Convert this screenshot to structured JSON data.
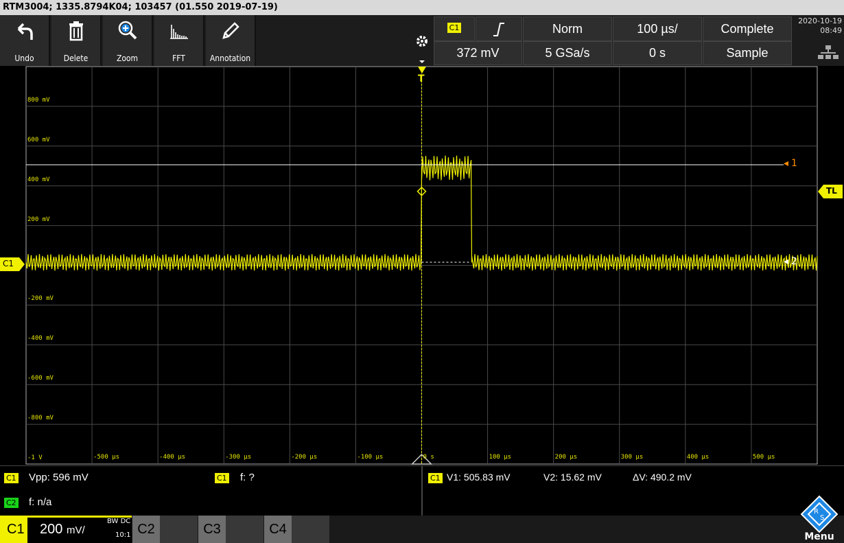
{
  "title_bar": "RTM3004; 1335.8794K04; 103457 (01.550 2019-07-19)",
  "toolbar": {
    "undo": "Undo",
    "delete": "Delete",
    "zoom": "Zoom",
    "fft": "FFT",
    "annotation": "Annotation"
  },
  "trigger": {
    "source": "C1",
    "mode": "Norm",
    "timebase": "100 µs/",
    "acq_state": "Complete",
    "level": "372 mV",
    "sample_rate": "5 GSa/s",
    "position": "0 s",
    "acq_mode": "Sample"
  },
  "datetime": {
    "date": "2020-10-19",
    "time": "08:49"
  },
  "colors": {
    "ch1": "#f0f000",
    "ch2": "#19d319",
    "marker": "#ff8c00"
  },
  "icons": [
    "undo-icon",
    "trash-icon",
    "zoom-icon",
    "fft-icon",
    "pen-icon",
    "gear-icon",
    "rising-edge-icon",
    "network-icon",
    "rs-logo-icon"
  ],
  "markers": {
    "ch1": "C1",
    "trigger": "T",
    "trigger_level": "TL",
    "cursor1": "1",
    "cursor2": "2"
  },
  "chart_data": {
    "type": "line",
    "title": "",
    "xlabel": "",
    "ylabel": "",
    "xlim": [
      -600,
      600
    ],
    "ylim": [
      -1000,
      1000
    ],
    "grid": true,
    "x_tick_labels": [
      "-500 µs",
      "-400 µs",
      "-300 µs",
      "-200 µs",
      "-100 µs",
      "0 s",
      "100 µs",
      "200 µs",
      "300 µs",
      "400 µs",
      "500 µs"
    ],
    "y_tick_labels": [
      "800 mV",
      "600 mV",
      "400 mV",
      "200 mV",
      "-200 mV",
      "-400 mV",
      "-600 mV",
      "-800 mV",
      "-1 V"
    ],
    "series": [
      {
        "name": "C1",
        "x": [
          -600,
          -1,
          0,
          75,
          76,
          600
        ],
        "y": [
          15,
          15,
          490,
          490,
          15,
          15
        ]
      }
    ],
    "cursors": {
      "v1_mv": 505.83,
      "v2_mv": 15.62
    }
  },
  "measurements": {
    "chip1": "C1",
    "vpp": "Vpp: 596 mV",
    "chip2": "C1",
    "freq1": "f: ?",
    "chip3": "C2",
    "freq2": "f: n/a",
    "chip4": "C1",
    "v1": "V1: 505.83 mV",
    "v2": "V2: 15.62 mV",
    "dv": "ΔV: 490.2 mV"
  },
  "channels": {
    "c1": "C1",
    "c1_scale": "200",
    "c1_unit": "mV/",
    "c1_bw": "BW DC",
    "c1_probe": "10:1",
    "c2": "C2",
    "c3": "C3",
    "c4": "C4"
  },
  "menu": "Menu"
}
